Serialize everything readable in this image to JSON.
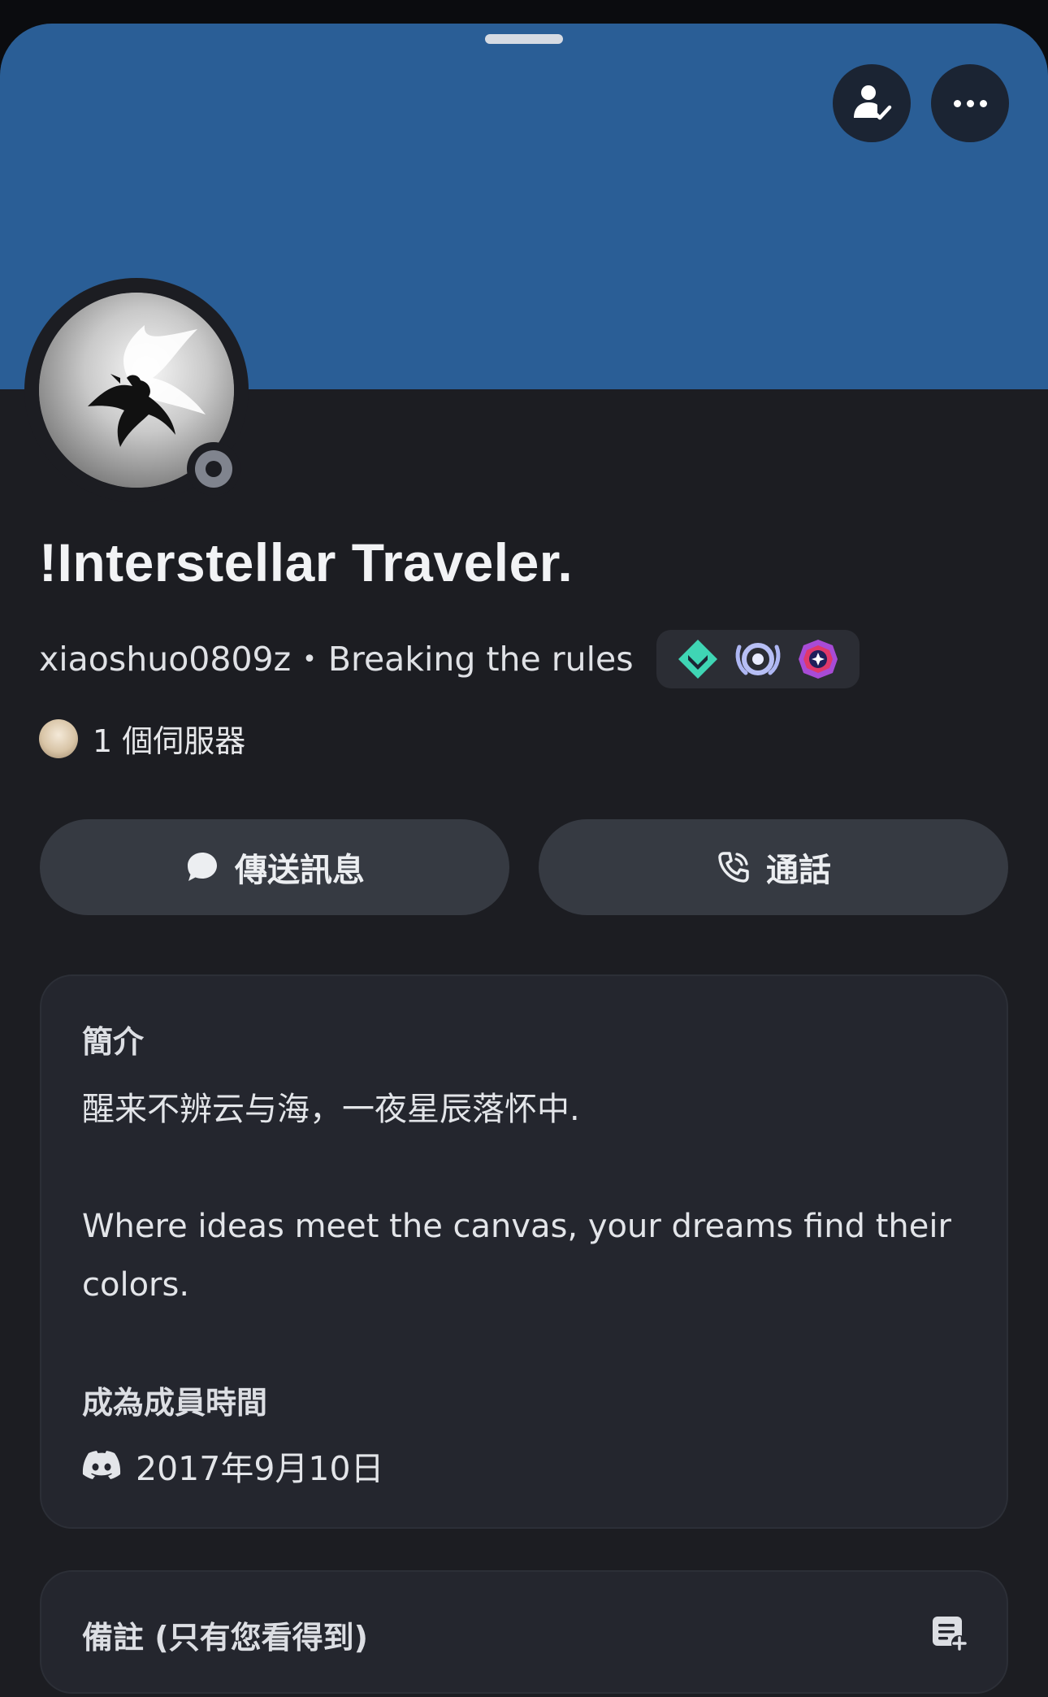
{
  "profile": {
    "display_name": "!Interstellar Traveler.",
    "username": "xiaoshuo0809z",
    "separator": "•",
    "custom_status": "Breaking the rules",
    "mutual_servers": "1 個伺服器",
    "status": "offline"
  },
  "actions": {
    "message_label": "傳送訊息",
    "call_label": "通話"
  },
  "about": {
    "heading": "簡介",
    "bio": "醒来不辨云与海，一夜星辰落怀中.\n\nWhere ideas meet the canvas, your dreams find their colors.",
    "member_since_heading": "成為成員時間",
    "member_since": "2017年9月10日"
  },
  "note": {
    "heading": "備註 (只有您看得到)"
  },
  "icons": {
    "friends": "person-check-icon",
    "more": "more-dots-icon",
    "message": "chat-bubble-icon",
    "call": "phone-icon",
    "discord": "discord-logo-icon",
    "note": "note-add-icon",
    "badges": [
      "hypesquad-balance-badge",
      "nitro-boost-badge",
      "quest-badge"
    ]
  },
  "colors": {
    "banner": "#2a5e96",
    "background": "#1c1d22",
    "card": "#24262e",
    "button": "#363a42"
  }
}
